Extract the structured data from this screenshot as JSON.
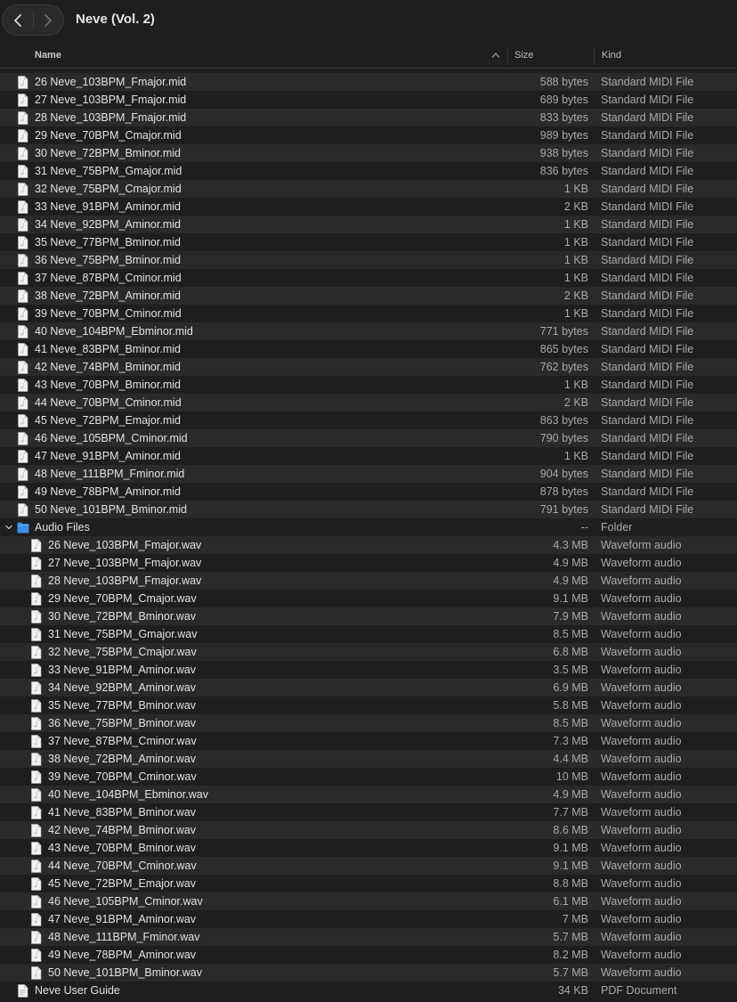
{
  "window": {
    "title": "Neve (Vol. 2)"
  },
  "columns": {
    "name": "Name",
    "size": "Size",
    "kind": "Kind"
  },
  "rows": [
    {
      "name": "26 Neve_103BPM_Fmajor.mid",
      "size": "588 bytes",
      "kind": "Standard MIDI File",
      "type": "file",
      "indent": 0
    },
    {
      "name": "27 Neve_103BPM_Fmajor.mid",
      "size": "689 bytes",
      "kind": "Standard MIDI File",
      "type": "file",
      "indent": 0
    },
    {
      "name": "28 Neve_103BPM_Fmajor.mid",
      "size": "833 bytes",
      "kind": "Standard MIDI File",
      "type": "file",
      "indent": 0
    },
    {
      "name": "29 Neve_70BPM_Cmajor.mid",
      "size": "989 bytes",
      "kind": "Standard MIDI File",
      "type": "file",
      "indent": 0
    },
    {
      "name": "30 Neve_72BPM_Bminor.mid",
      "size": "938 bytes",
      "kind": "Standard MIDI File",
      "type": "file",
      "indent": 0
    },
    {
      "name": "31 Neve_75BPM_Gmajor.mid",
      "size": "836 bytes",
      "kind": "Standard MIDI File",
      "type": "file",
      "indent": 0
    },
    {
      "name": "32 Neve_75BPM_Cmajor.mid",
      "size": "1 KB",
      "kind": "Standard MIDI File",
      "type": "file",
      "indent": 0
    },
    {
      "name": "33 Neve_91BPM_Aminor.mid",
      "size": "2 KB",
      "kind": "Standard MIDI File",
      "type": "file",
      "indent": 0
    },
    {
      "name": "34 Neve_92BPM_Aminor.mid",
      "size": "1 KB",
      "kind": "Standard MIDI File",
      "type": "file",
      "indent": 0
    },
    {
      "name": "35 Neve_77BPM_Bminor.mid",
      "size": "1 KB",
      "kind": "Standard MIDI File",
      "type": "file",
      "indent": 0
    },
    {
      "name": "36 Neve_75BPM_Bminor.mid",
      "size": "1 KB",
      "kind": "Standard MIDI File",
      "type": "file",
      "indent": 0
    },
    {
      "name": "37 Neve_87BPM_Cminor.mid",
      "size": "1 KB",
      "kind": "Standard MIDI File",
      "type": "file",
      "indent": 0
    },
    {
      "name": "38 Neve_72BPM_Aminor.mid",
      "size": "2 KB",
      "kind": "Standard MIDI File",
      "type": "file",
      "indent": 0
    },
    {
      "name": "39 Neve_70BPM_Cminor.mid",
      "size": "1 KB",
      "kind": "Standard MIDI File",
      "type": "file",
      "indent": 0
    },
    {
      "name": "40 Neve_104BPM_Ebminor.mid",
      "size": "771 bytes",
      "kind": "Standard MIDI File",
      "type": "file",
      "indent": 0
    },
    {
      "name": "41 Neve_83BPM_Bminor.mid",
      "size": "865 bytes",
      "kind": "Standard MIDI File",
      "type": "file",
      "indent": 0
    },
    {
      "name": "42 Neve_74BPM_Bminor.mid",
      "size": "762 bytes",
      "kind": "Standard MIDI File",
      "type": "file",
      "indent": 0
    },
    {
      "name": "43 Neve_70BPM_Bminor.mid",
      "size": "1 KB",
      "kind": "Standard MIDI File",
      "type": "file",
      "indent": 0
    },
    {
      "name": "44 Neve_70BPM_Cminor.mid",
      "size": "2 KB",
      "kind": "Standard MIDI File",
      "type": "file",
      "indent": 0
    },
    {
      "name": "45 Neve_72BPM_Emajor.mid",
      "size": "863 bytes",
      "kind": "Standard MIDI File",
      "type": "file",
      "indent": 0
    },
    {
      "name": "46 Neve_105BPM_Cminor.mid",
      "size": "790 bytes",
      "kind": "Standard MIDI File",
      "type": "file",
      "indent": 0
    },
    {
      "name": "47 Neve_91BPM_Aminor.mid",
      "size": "1 KB",
      "kind": "Standard MIDI File",
      "type": "file",
      "indent": 0
    },
    {
      "name": "48 Neve_111BPM_Fminor.mid",
      "size": "904 bytes",
      "kind": "Standard MIDI File",
      "type": "file",
      "indent": 0
    },
    {
      "name": "49 Neve_78BPM_Aminor.mid",
      "size": "878 bytes",
      "kind": "Standard MIDI File",
      "type": "file",
      "indent": 0
    },
    {
      "name": "50 Neve_101BPM_Bminor.mid",
      "size": "791 bytes",
      "kind": "Standard MIDI File",
      "type": "file",
      "indent": 0
    },
    {
      "name": "Audio Files",
      "size": "--",
      "kind": "Folder",
      "type": "folder",
      "indent": 0,
      "expanded": true
    },
    {
      "name": "26 Neve_103BPM_Fmajor.wav",
      "size": "4.3 MB",
      "kind": "Waveform audio",
      "type": "file",
      "indent": 1
    },
    {
      "name": "27 Neve_103BPM_Fmajor.wav",
      "size": "4.9 MB",
      "kind": "Waveform audio",
      "type": "file",
      "indent": 1
    },
    {
      "name": "28 Neve_103BPM_Fmajor.wav",
      "size": "4.9 MB",
      "kind": "Waveform audio",
      "type": "file",
      "indent": 1
    },
    {
      "name": "29 Neve_70BPM_Cmajor.wav",
      "size": "9.1 MB",
      "kind": "Waveform audio",
      "type": "file",
      "indent": 1
    },
    {
      "name": "30 Neve_72BPM_Bminor.wav",
      "size": "7.9 MB",
      "kind": "Waveform audio",
      "type": "file",
      "indent": 1
    },
    {
      "name": "31 Neve_75BPM_Gmajor.wav",
      "size": "8.5 MB",
      "kind": "Waveform audio",
      "type": "file",
      "indent": 1
    },
    {
      "name": "32 Neve_75BPM_Cmajor.wav",
      "size": "6.8 MB",
      "kind": "Waveform audio",
      "type": "file",
      "indent": 1
    },
    {
      "name": "33 Neve_91BPM_Aminor.wav",
      "size": "3.5 MB",
      "kind": "Waveform audio",
      "type": "file",
      "indent": 1
    },
    {
      "name": "34 Neve_92BPM_Aminor.wav",
      "size": "6.9 MB",
      "kind": "Waveform audio",
      "type": "file",
      "indent": 1
    },
    {
      "name": "35 Neve_77BPM_Bminor.wav",
      "size": "5.8 MB",
      "kind": "Waveform audio",
      "type": "file",
      "indent": 1
    },
    {
      "name": "36 Neve_75BPM_Bminor.wav",
      "size": "8.5 MB",
      "kind": "Waveform audio",
      "type": "file",
      "indent": 1
    },
    {
      "name": "37 Neve_87BPM_Cminor.wav",
      "size": "7.3 MB",
      "kind": "Waveform audio",
      "type": "file",
      "indent": 1
    },
    {
      "name": "38 Neve_72BPM_Aminor.wav",
      "size": "4.4 MB",
      "kind": "Waveform audio",
      "type": "file",
      "indent": 1
    },
    {
      "name": "39 Neve_70BPM_Cminor.wav",
      "size": "10 MB",
      "kind": "Waveform audio",
      "type": "file",
      "indent": 1
    },
    {
      "name": "40 Neve_104BPM_Ebminor.wav",
      "size": "4.9 MB",
      "kind": "Waveform audio",
      "type": "file",
      "indent": 1
    },
    {
      "name": "41 Neve_83BPM_Bminor.wav",
      "size": "7.7 MB",
      "kind": "Waveform audio",
      "type": "file",
      "indent": 1
    },
    {
      "name": "42 Neve_74BPM_Bminor.wav",
      "size": "8.6 MB",
      "kind": "Waveform audio",
      "type": "file",
      "indent": 1
    },
    {
      "name": "43 Neve_70BPM_Bminor.wav",
      "size": "9.1 MB",
      "kind": "Waveform audio",
      "type": "file",
      "indent": 1
    },
    {
      "name": "44 Neve_70BPM_Cminor.wav",
      "size": "9.1 MB",
      "kind": "Waveform audio",
      "type": "file",
      "indent": 1
    },
    {
      "name": "45 Neve_72BPM_Emajor.wav",
      "size": "8.8 MB",
      "kind": "Waveform audio",
      "type": "file",
      "indent": 1
    },
    {
      "name": "46 Neve_105BPM_Cminor.wav",
      "size": "6.1 MB",
      "kind": "Waveform audio",
      "type": "file",
      "indent": 1
    },
    {
      "name": "47 Neve_91BPM_Aminor.wav",
      "size": "7 MB",
      "kind": "Waveform audio",
      "type": "file",
      "indent": 1
    },
    {
      "name": "48 Neve_111BPM_Fminor.wav",
      "size": "5.7 MB",
      "kind": "Waveform audio",
      "type": "file",
      "indent": 1
    },
    {
      "name": "49 Neve_78BPM_Aminor.wav",
      "size": "8.2 MB",
      "kind": "Waveform audio",
      "type": "file",
      "indent": 1
    },
    {
      "name": "50 Neve_101BPM_Bminor.wav",
      "size": "5.7 MB",
      "kind": "Waveform audio",
      "type": "file",
      "indent": 1
    },
    {
      "name": "Neve User Guide",
      "size": "34 KB",
      "kind": "PDF Document",
      "type": "pdf",
      "indent": 0
    }
  ],
  "colors": {
    "background": "#1e1e1e",
    "row_stripe": "#2a2a2a",
    "folder": "#3b8eea",
    "text": "#e2e2e2",
    "secondary_text": "#a9a9a9"
  },
  "icons": {
    "back": "chevron-left-icon",
    "forward": "chevron-right-icon",
    "sort": "chevron-up-icon",
    "disclosure": "chevron-down-icon",
    "midi": "midi-file-icon",
    "wav": "audio-file-icon",
    "folder": "folder-icon",
    "pdf": "pdf-file-icon"
  }
}
